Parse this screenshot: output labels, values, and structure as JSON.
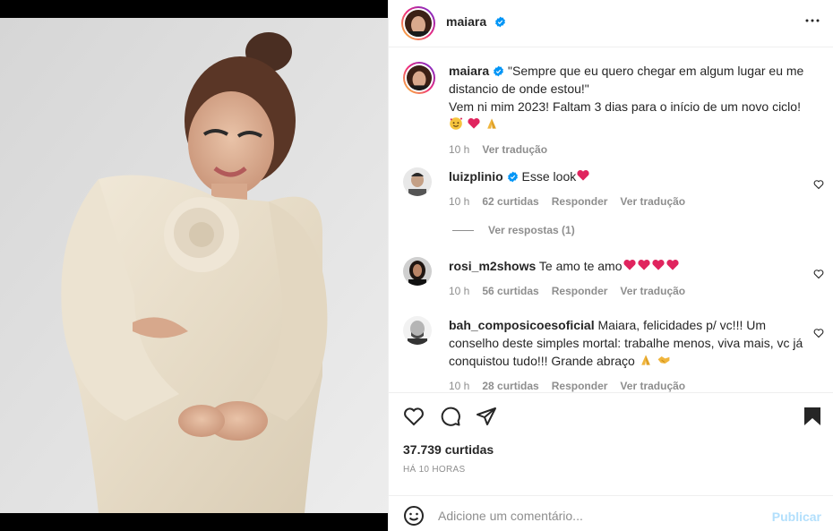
{
  "post": {
    "username": "maiara",
    "verified": true,
    "more_icon": "more-horizontal-icon"
  },
  "caption": {
    "username": "maiara",
    "text_line1": "\"Sempre que eu quero chegar em algum lugar eu me distancio de onde estou!\"",
    "text_line2": "Vem ni mim 2023! Faltam 3 dias para o início de um novo ciclo!",
    "emojis": [
      "smiling-face-with-hearts",
      "red-heart",
      "folded-hands"
    ],
    "time": "10 h",
    "translate": "Ver tradução"
  },
  "comments": [
    {
      "username": "luizplinio",
      "verified": true,
      "text": "Esse look",
      "emojis": [
        "red-heart"
      ],
      "time": "10 h",
      "likes": "62 curtidas",
      "reply": "Responder",
      "translate": "Ver tradução",
      "view_replies": "Ver respostas (1)"
    },
    {
      "username": "rosi_m2shows",
      "verified": false,
      "text": "Te amo te amo",
      "emojis": [
        "red-heart",
        "red-heart",
        "red-heart",
        "red-heart"
      ],
      "time": "10 h",
      "likes": "56 curtidas",
      "reply": "Responder",
      "translate": "Ver tradução"
    },
    {
      "username": "bah_composicoesoficial",
      "verified": false,
      "text": "Maiara, felicidades p/ vc!!! Um conselho deste simples mortal: trabalhe menos, viva mais, vc já conquistou tudo!!! Grande abraço",
      "emojis": [
        "folded-hands",
        "handshake"
      ],
      "time": "10 h",
      "likes": "28 curtidas",
      "reply": "Responder",
      "translate": "Ver tradução"
    }
  ],
  "stats": {
    "likes": "37.739 curtidas",
    "posted": "HÁ 10 HORAS"
  },
  "add_comment": {
    "placeholder": "Adicione um comentário...",
    "post_label": "Publicar"
  },
  "colors": {
    "text": "#262626",
    "secondary": "#8e8e8e",
    "verified": "#0095f6",
    "heart": "#ed4956",
    "publish_disabled": "#b2dffc"
  }
}
